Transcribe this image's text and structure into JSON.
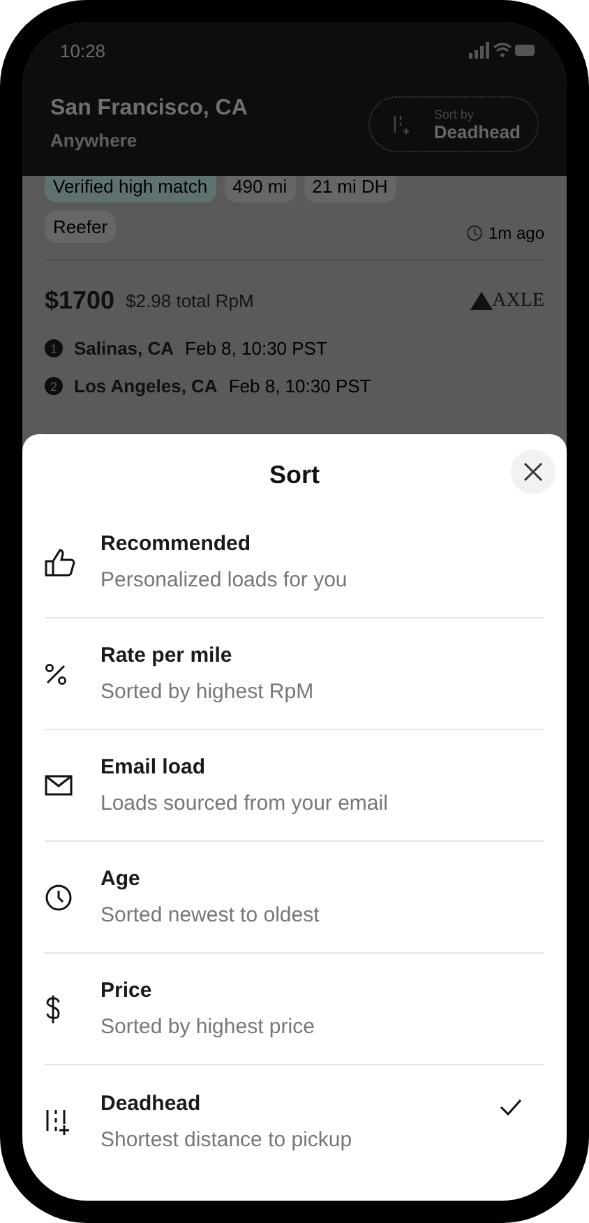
{
  "status_bar": {
    "time": "10:28"
  },
  "header": {
    "origin": "San Francisco, CA",
    "destination": "Anywhere",
    "sort_button": {
      "label": "Sort by",
      "value": "Deadhead"
    }
  },
  "loads": [
    {
      "tags": [
        {
          "text": "Verified high match",
          "kind": "verified"
        },
        {
          "text": "490 mi",
          "kind": "plain"
        },
        {
          "text": "21 mi DH",
          "kind": "plain"
        }
      ],
      "tags2": [
        {
          "text": "Reefer"
        }
      ],
      "age": "1m ago"
    },
    {
      "price": "$1700",
      "rpm": "$2.98 total RpM",
      "logo": "AXLE",
      "stops": [
        {
          "number": "1",
          "city": "Salinas, CA",
          "time": "Feb 8, 10:30 PST"
        },
        {
          "number": "2",
          "city": "Los Angeles, CA",
          "time": "Feb 8, 10:30 PST"
        }
      ]
    }
  ],
  "sheet": {
    "title": "Sort",
    "options": [
      {
        "title": "Recommended",
        "subtitle": "Personalized loads for you",
        "selected": false
      },
      {
        "title": "Rate per mile",
        "subtitle": "Sorted by highest RpM",
        "selected": false
      },
      {
        "title": "Email load",
        "subtitle": "Loads sourced from your email",
        "selected": false
      },
      {
        "title": "Age",
        "subtitle": "Sorted newest to oldest",
        "selected": false
      },
      {
        "title": "Price",
        "subtitle": "Sorted by highest price",
        "selected": false
      },
      {
        "title": "Deadhead",
        "subtitle": "Shortest distance to pickup",
        "selected": true
      }
    ]
  }
}
